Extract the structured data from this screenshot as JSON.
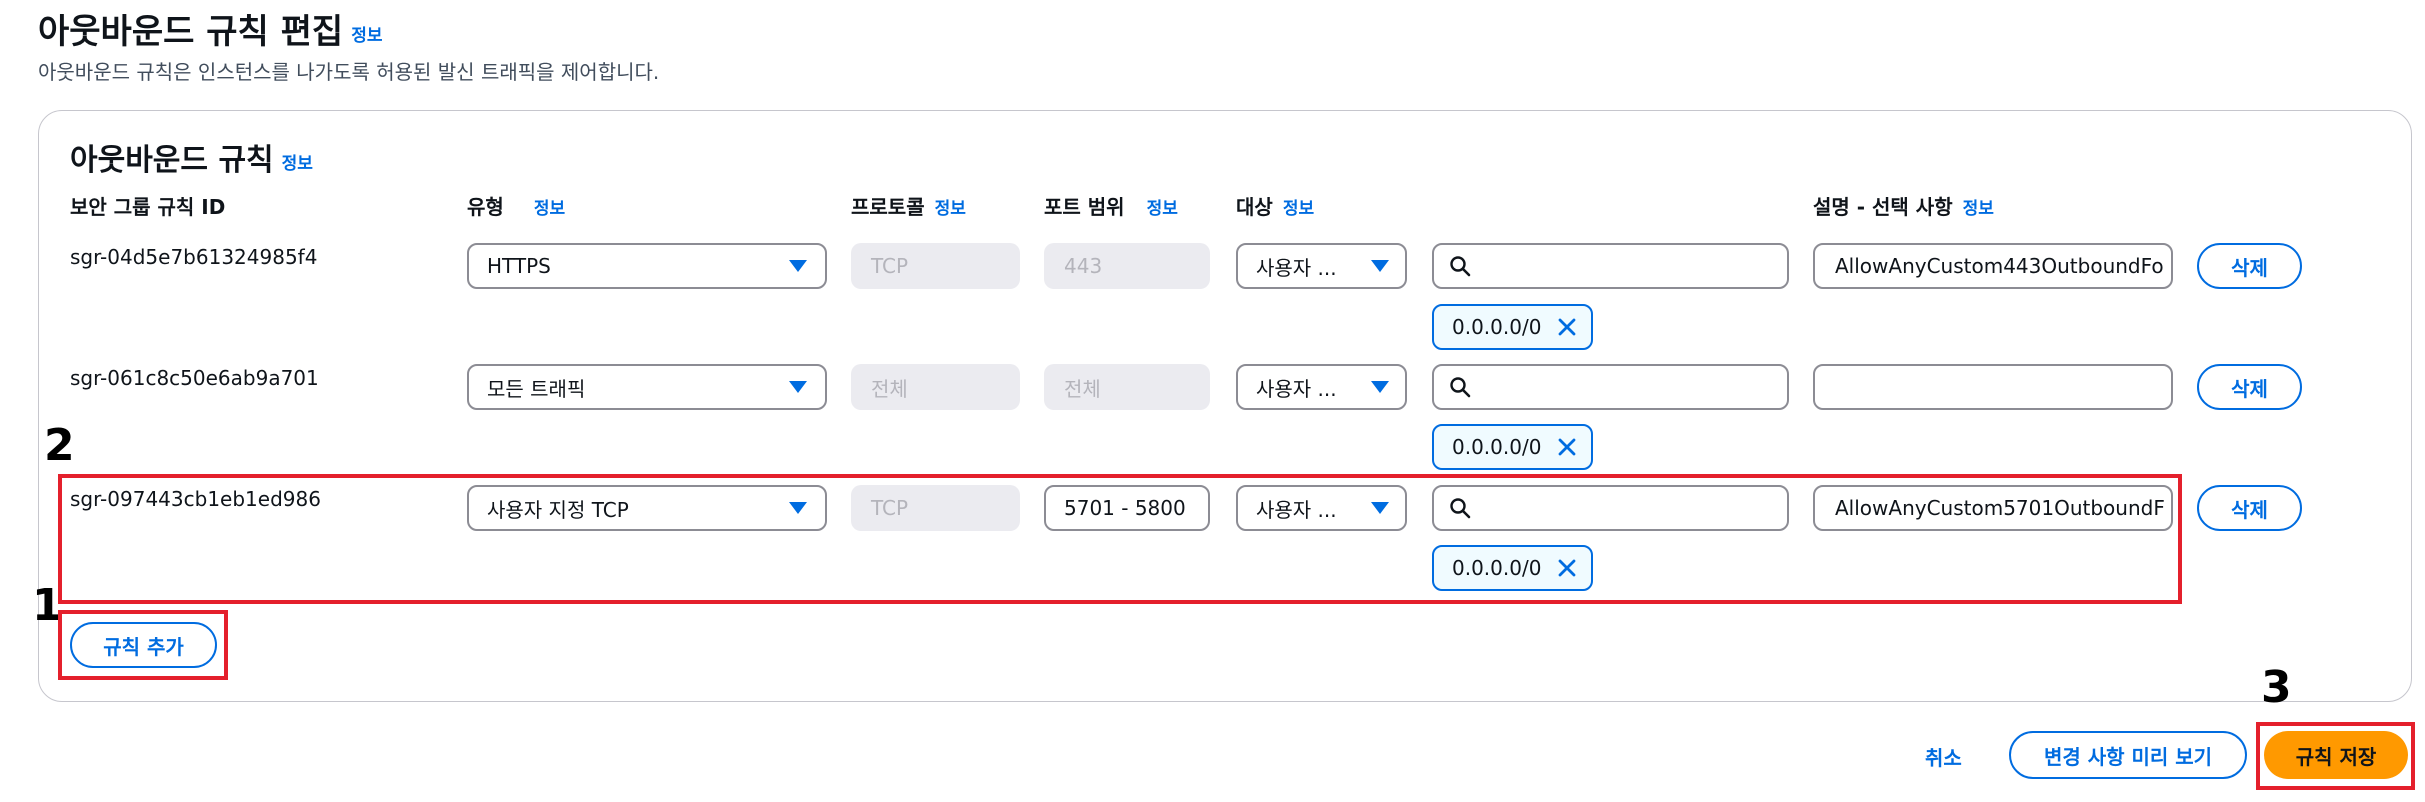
{
  "header": {
    "title": "아웃바운드 규칙 편집",
    "info": "정보",
    "description": "아웃바운드 규칙은 인스턴스를 나가도록 허용된 발신 트래픽을 제어합니다."
  },
  "panel": {
    "title": "아웃바운드 규칙",
    "info": "정보",
    "columns": {
      "rule_id": "보안 그룹 규칙 ID",
      "type": "유형",
      "protocol": "프로토콜",
      "port_range": "포트 범위",
      "destination": "대상",
      "description": "설명 - 선택 사항",
      "info": "정보"
    },
    "rules": [
      {
        "id": "sgr-04d5e7b61324985f4",
        "type": "HTTPS",
        "protocol": "TCP",
        "port": "443",
        "destination": "사용자 ...",
        "cidr": "0.0.0.0/0",
        "description": "AllowAnyCustom443OutboundFo",
        "delete": "삭제"
      },
      {
        "id": "sgr-061c8c50e6ab9a701",
        "type": "모든 트래픽",
        "protocol": "전체",
        "port": "전체",
        "destination": "사용자 ...",
        "cidr": "0.0.0.0/0",
        "description": "",
        "delete": "삭제"
      },
      {
        "id": "sgr-097443cb1eb1ed986",
        "type": "사용자 지정 TCP",
        "protocol": "TCP",
        "port": "5701 - 5800",
        "destination": "사용자 ...",
        "cidr": "0.0.0.0/0",
        "description": "AllowAnyCustom5701OutboundF",
        "delete": "삭제"
      }
    ],
    "add_rule": "규칙 추가"
  },
  "footer": {
    "cancel": "취소",
    "preview": "변경 사항 미리 보기",
    "save": "규칙 저장"
  },
  "annotations": {
    "step1": "1",
    "step2": "2",
    "step3": "3"
  },
  "colors": {
    "accent": "#006ce0",
    "primary_button": "#ff9900",
    "highlight_box": "#e4202c"
  }
}
